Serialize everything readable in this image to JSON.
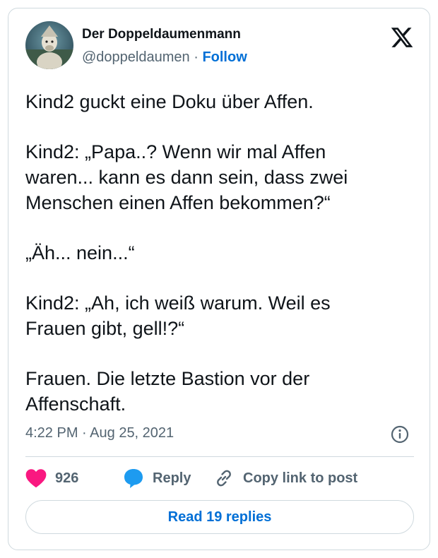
{
  "author": {
    "name": "Der Doppeldaumenmann",
    "handle": "@doppeldaumen",
    "separator": "·",
    "follow_label": "Follow"
  },
  "post": {
    "paragraphs": [
      [
        "Kind2 guckt eine Doku über Affen."
      ],
      [
        "Kind2: „Papa..? Wenn wir mal Affen",
        "waren... kann es dann sein, dass zwei",
        "Menschen einen Affen bekommen?“"
      ],
      [
        "„Äh... nein...“"
      ],
      [
        "Kind2: „Ah, ich weiß warum. Weil es",
        "Frauen gibt, gell!?“"
      ],
      [
        "Frauen. Die letzte Bastion vor der",
        "Affenschaft."
      ]
    ],
    "time": "4:22 PM",
    "date_separator": "·",
    "date": "Aug 25, 2021"
  },
  "actions": {
    "like_count": "926",
    "reply_label": "Reply",
    "copy_link_label": "Copy link to post"
  },
  "read_replies_label": "Read 19 replies",
  "colors": {
    "link": "#006fd6",
    "like": "#f91880",
    "reply_bubble": "#1d9bf0",
    "muted_text": "#536471",
    "border": "#cfd9de"
  },
  "icons": [
    "x-logo-icon",
    "heart-icon",
    "reply-bubble-icon",
    "link-icon",
    "info-icon"
  ]
}
